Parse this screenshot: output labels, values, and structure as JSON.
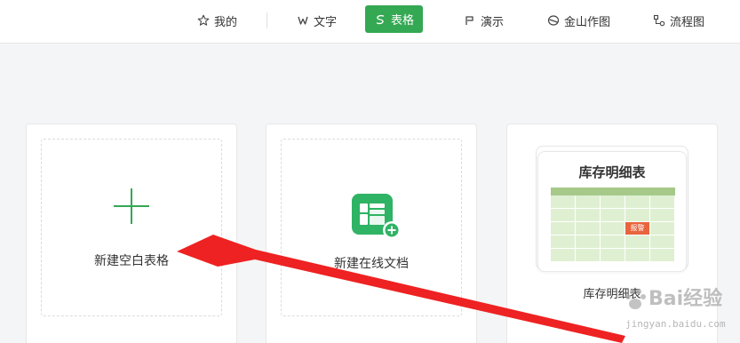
{
  "nav": {
    "items": [
      {
        "label": "我的",
        "icon": "star-icon",
        "active": false
      },
      {
        "label": "文字",
        "icon": "word-icon",
        "active": false
      },
      {
        "label": "表格",
        "icon": "sheet-icon",
        "active": true
      },
      {
        "label": "演示",
        "icon": "presentation-icon",
        "active": false
      },
      {
        "label": "金山作图",
        "icon": "kingsoft-draw-icon",
        "active": false
      },
      {
        "label": "流程图",
        "icon": "flowchart-icon",
        "active": false
      }
    ]
  },
  "cards": {
    "blank": {
      "label": "新建空白表格",
      "icon": "plus-icon"
    },
    "online": {
      "label": "新建在线文档",
      "icon": "online-sheet-add-icon"
    },
    "template": {
      "preview_title": "库存明细表",
      "badge": "报警",
      "name": "库存明细表"
    }
  },
  "watermark": {
    "main": "Bai经验",
    "sub": "jingyan.baidu.com"
  },
  "colors": {
    "accent": "#34a853",
    "arrow": "#ee2222",
    "table_header": "#a6c98a",
    "table_cell": "#dff0d2",
    "badge": "#e8643c"
  }
}
